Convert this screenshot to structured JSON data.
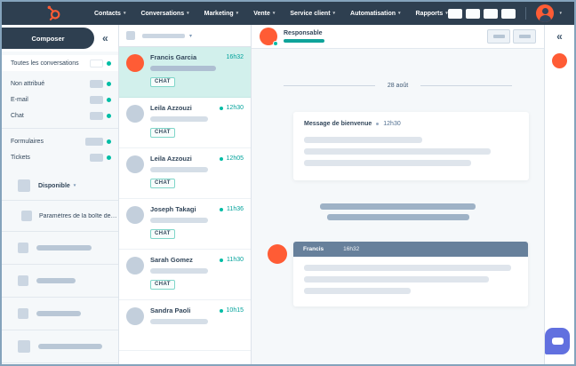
{
  "nav": {
    "items": [
      {
        "label": "Contacts"
      },
      {
        "label": "Conversations"
      },
      {
        "label": "Marketing"
      },
      {
        "label": "Vente"
      },
      {
        "label": "Service client"
      },
      {
        "label": "Automatisation"
      },
      {
        "label": "Rapports"
      }
    ]
  },
  "sidebar": {
    "composer_label": "Composer",
    "filters": [
      {
        "label": "Toutes les conversations"
      },
      {
        "label": "Non attribué"
      },
      {
        "label": "E-mail"
      },
      {
        "label": "Chat"
      },
      {
        "label": "Formulaires"
      },
      {
        "label": "Tickets"
      }
    ],
    "availability_label": "Disponible",
    "settings_label": "Paramètres de la boîte de…"
  },
  "conversation_list": {
    "items": [
      {
        "name": "Francis Garcia",
        "time": "16h32",
        "tag": "CHAT"
      },
      {
        "name": "Leila Azzouzi",
        "time": "12h30",
        "tag": "CHAT"
      },
      {
        "name": "Leila Azzouzi",
        "time": "12h05",
        "tag": "CHAT"
      },
      {
        "name": "Joseph Takagi",
        "time": "11h36",
        "tag": "CHAT"
      },
      {
        "name": "Sarah Gomez",
        "time": "11h30",
        "tag": "CHAT"
      },
      {
        "name": "Sandra Paoli",
        "time": "10h15"
      }
    ]
  },
  "thread": {
    "owner_label": "Responsable",
    "date_divider": "28 août",
    "welcome": {
      "title": "Message de bienvenue",
      "time": "12h30"
    },
    "message": {
      "author": "Francis",
      "time": "16h32"
    }
  },
  "colors": {
    "nav_bg": "#2e3f50",
    "orange": "#ff5c35",
    "teal": "#00bda5",
    "teal_dark": "#0fa39a",
    "time_teal": "#00a29b",
    "selected_convo_bg": "#d2f0ec",
    "panel_bg": "#f5f8fa",
    "skeleton": "#cbd6e2",
    "skeleton_dark": "#aebfd2",
    "slate_header": "#67809b",
    "sys_bar": "#9eb2c6",
    "card_bar": "#dfe5ec",
    "text_dark": "#33475b",
    "text_muted": "#516f90",
    "frame_border": "#85a3bc",
    "widget_purple": "#6170df"
  }
}
